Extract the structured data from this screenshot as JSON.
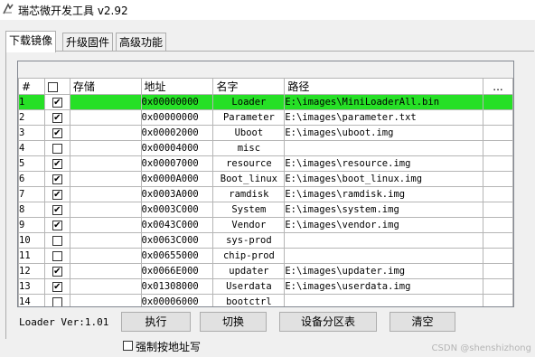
{
  "window": {
    "title": "瑞芯微开发工具 v2.92"
  },
  "tabs": [
    {
      "label": "下载镜像",
      "active": true
    },
    {
      "label": "升级固件",
      "active": false
    },
    {
      "label": "高级功能",
      "active": false
    }
  ],
  "table": {
    "columns": {
      "num": "#",
      "check": "☐",
      "storage": "存储",
      "address": "地址",
      "name": "名字",
      "path": "路径",
      "more": "..."
    },
    "rows": [
      {
        "num": "1",
        "checked": true,
        "storage": "",
        "address": "0x00000000",
        "name": "Loader",
        "path": "E:\\images\\MiniLoaderAll.bin",
        "selected": true
      },
      {
        "num": "2",
        "checked": true,
        "storage": "",
        "address": "0x00000000",
        "name": "Parameter",
        "path": "E:\\images\\parameter.txt"
      },
      {
        "num": "3",
        "checked": true,
        "storage": "",
        "address": "0x00002000",
        "name": "Uboot",
        "path": "E:\\images\\uboot.img"
      },
      {
        "num": "4",
        "checked": false,
        "storage": "",
        "address": "0x00004000",
        "name": "misc",
        "path": ""
      },
      {
        "num": "5",
        "checked": true,
        "storage": "",
        "address": "0x00007000",
        "name": "resource",
        "path": "E:\\images\\resource.img"
      },
      {
        "num": "6",
        "checked": true,
        "storage": "",
        "address": "0x0000A000",
        "name": "Boot_linux",
        "path": "E:\\images\\boot_linux.img"
      },
      {
        "num": "7",
        "checked": true,
        "storage": "",
        "address": "0x0003A000",
        "name": "ramdisk",
        "path": "E:\\images\\ramdisk.img"
      },
      {
        "num": "8",
        "checked": true,
        "storage": "",
        "address": "0x0003C000",
        "name": "System",
        "path": "E:\\images\\system.img"
      },
      {
        "num": "9",
        "checked": true,
        "storage": "",
        "address": "0x0043C000",
        "name": "Vendor",
        "path": "E:\\images\\vendor.img"
      },
      {
        "num": "10",
        "checked": false,
        "storage": "",
        "address": "0x0063C000",
        "name": "sys-prod",
        "path": ""
      },
      {
        "num": "11",
        "checked": false,
        "storage": "",
        "address": "0x00655000",
        "name": "chip-prod",
        "path": ""
      },
      {
        "num": "12",
        "checked": true,
        "storage": "",
        "address": "0x0066E000",
        "name": "updater",
        "path": "E:\\images\\updater.img"
      },
      {
        "num": "13",
        "checked": true,
        "storage": "",
        "address": "0x01308000",
        "name": "Userdata",
        "path": "E:\\images\\userdata.img"
      },
      {
        "num": "14",
        "checked": false,
        "storage": "",
        "address": "0x00006000",
        "name": "bootctrl",
        "path": ""
      }
    ]
  },
  "footer": {
    "loader_version": "Loader Ver:1.01",
    "execute_label": "执行",
    "switch_label": "切换",
    "partition_label": "设备分区表",
    "clear_label": "清空",
    "force_address_label": "强制按地址写"
  },
  "watermark": "CSDN @shenshizhong",
  "colors": {
    "selected_row": "#26e026",
    "window_bg": "#f0f0f0"
  },
  "icons": {
    "app": "rockchip-logo-icon",
    "checkbox_checked": "checkmark-icon"
  }
}
